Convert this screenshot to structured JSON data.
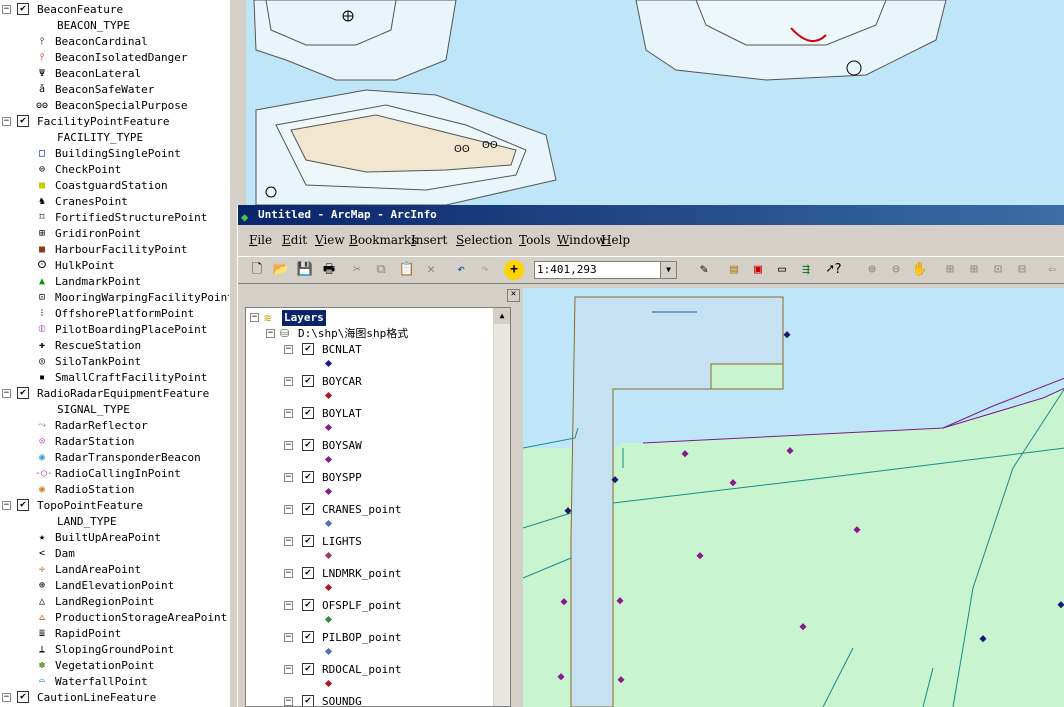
{
  "legend": {
    "items": [
      {
        "kind": "group",
        "label": "BeaconFeature"
      },
      {
        "kind": "field",
        "label": "BEACON_TYPE"
      },
      {
        "kind": "item",
        "label": "BeaconCardinal",
        "icon": "beacon-cardinal-icon",
        "glyph": "⫯",
        "color": "#000"
      },
      {
        "kind": "item",
        "label": "BeaconIsolatedDanger",
        "icon": "beacon-isolated-danger-icon",
        "glyph": "⫯",
        "color": "#d00"
      },
      {
        "kind": "item",
        "label": "BeaconLateral",
        "icon": "beacon-lateral-icon",
        "glyph": "Ψ",
        "color": "#000"
      },
      {
        "kind": "item",
        "label": "BeaconSafeWater",
        "icon": "beacon-safe-water-icon",
        "glyph": "ǎ",
        "color": "#000"
      },
      {
        "kind": "item",
        "label": "BeaconSpecialPurpose",
        "icon": "beacon-special-purpose-icon",
        "glyph": "ʘʘ",
        "color": "#000"
      },
      {
        "kind": "group",
        "label": "FacilityPointFeature"
      },
      {
        "kind": "field",
        "label": "FACILITY_TYPE"
      },
      {
        "kind": "item",
        "label": "BuildingSinglePoint",
        "icon": "building-single-point-icon",
        "glyph": "□",
        "color": "#00c"
      },
      {
        "kind": "item",
        "label": "CheckPoint",
        "icon": "check-point-icon",
        "glyph": "⊖",
        "color": "#000"
      },
      {
        "kind": "item",
        "label": "CoastguardStation",
        "icon": "coastguard-station-icon",
        "glyph": "■",
        "color": "#cc0"
      },
      {
        "kind": "item",
        "label": "CranesPoint",
        "icon": "cranes-point-icon",
        "glyph": "♞",
        "color": "#000"
      },
      {
        "kind": "item",
        "label": "FortifiedStructurePoint",
        "icon": "fortified-structure-icon",
        "glyph": "⌑",
        "color": "#000"
      },
      {
        "kind": "item",
        "label": "GridironPoint",
        "icon": "gridiron-point-icon",
        "glyph": "⊞",
        "color": "#000"
      },
      {
        "kind": "item",
        "label": "HarbourFacilityPoint",
        "icon": "harbour-facility-icon",
        "glyph": "■",
        "color": "#8b3a1a"
      },
      {
        "kind": "item",
        "label": "HulkPoint",
        "icon": "hulk-point-icon",
        "glyph": "ⵙ",
        "color": "#000"
      },
      {
        "kind": "item",
        "label": "LandmarkPoint",
        "icon": "landmark-point-icon",
        "glyph": "▲",
        "color": "#090"
      },
      {
        "kind": "item",
        "label": "MooringWarpingFacilityPoint",
        "icon": "mooring-warping-icon",
        "glyph": "⊡",
        "color": "#000"
      },
      {
        "kind": "item",
        "label": "OffshorePlatformPoint",
        "icon": "offshore-platform-icon",
        "glyph": "⁝",
        "color": "#000"
      },
      {
        "kind": "item",
        "label": "PilotBoardingPlacePoint",
        "icon": "pilot-boarding-icon",
        "glyph": "⦶",
        "color": "#a050c0"
      },
      {
        "kind": "item",
        "label": "RescueStation",
        "icon": "rescue-station-icon",
        "glyph": "✚",
        "color": "#000"
      },
      {
        "kind": "item",
        "label": "SiloTankPoint",
        "icon": "silo-tank-icon",
        "glyph": "◎",
        "color": "#000"
      },
      {
        "kind": "item",
        "label": "SmallCraftFacilityPoint",
        "icon": "small-craft-facility-icon",
        "glyph": "▪",
        "color": "#000"
      },
      {
        "kind": "group",
        "label": "RadioRadarEquipmentFeature"
      },
      {
        "kind": "field",
        "label": "SIGNAL_TYPE"
      },
      {
        "kind": "item",
        "label": "RadarReflector",
        "icon": "radar-reflector-icon",
        "glyph": "⤳",
        "color": "#888"
      },
      {
        "kind": "item",
        "label": "RadarStation",
        "icon": "radar-station-icon",
        "glyph": "⊙",
        "color": "#c040c0"
      },
      {
        "kind": "item",
        "label": "RadarTransponderBeacon",
        "icon": "radar-transponder-icon",
        "glyph": "◉",
        "color": "#3aa0d0"
      },
      {
        "kind": "item",
        "label": "RadioCallingInPoint",
        "icon": "radio-calling-in-icon",
        "glyph": "-○-",
        "color": "#c040c0"
      },
      {
        "kind": "item",
        "label": "RadioStation",
        "icon": "radio-station-icon",
        "glyph": "◉",
        "color": "#d08020"
      },
      {
        "kind": "group",
        "label": "TopoPointFeature"
      },
      {
        "kind": "field",
        "label": "LAND_TYPE"
      },
      {
        "kind": "item",
        "label": "BuiltUpAreaPoint",
        "icon": "built-up-area-icon",
        "glyph": "★",
        "color": "#000"
      },
      {
        "kind": "item",
        "label": "Dam",
        "icon": "dam-icon",
        "glyph": "<",
        "color": "#000"
      },
      {
        "kind": "item",
        "label": "LandAreaPoint",
        "icon": "land-area-icon",
        "glyph": "✛",
        "color": "#b07020"
      },
      {
        "kind": "item",
        "label": "LandElevationPoint",
        "icon": "land-elevation-icon",
        "glyph": "⊕",
        "color": "#000"
      },
      {
        "kind": "item",
        "label": "LandRegionPoint",
        "icon": "land-region-icon",
        "glyph": "△",
        "color": "#000"
      },
      {
        "kind": "item",
        "label": "ProductionStorageAreaPoint",
        "icon": "production-storage-icon",
        "glyph": "⩟",
        "color": "#c08040"
      },
      {
        "kind": "item",
        "label": "RapidPoint",
        "icon": "rapid-point-icon",
        "glyph": "≣",
        "color": "#000"
      },
      {
        "kind": "item",
        "label": "SlopingGroundPoint",
        "icon": "sloping-ground-icon",
        "glyph": "⍊",
        "color": "#000"
      },
      {
        "kind": "item",
        "label": "VegetationPoint",
        "icon": "vegetation-point-icon",
        "glyph": "✽",
        "color": "#4a8a20"
      },
      {
        "kind": "item",
        "label": "WaterfallPoint",
        "icon": "waterfall-point-icon",
        "glyph": "⌓",
        "color": "#3aa0d0"
      },
      {
        "kind": "group",
        "label": "CautionLineFeature"
      }
    ]
  },
  "window": {
    "title": "Untitled - ArcMap - ArcInfo",
    "menus": [
      {
        "label": "File",
        "u": "F",
        "rest": "ile"
      },
      {
        "label": "Edit",
        "u": "E",
        "rest": "dit"
      },
      {
        "label": "View",
        "u": "V",
        "rest": "iew"
      },
      {
        "label": "Bookmarks",
        "u": "B",
        "rest": "ookmarks"
      },
      {
        "label": "Insert",
        "u": "I",
        "rest": "nsert"
      },
      {
        "label": "Selection",
        "u": "S",
        "rest": "election"
      },
      {
        "label": "Tools",
        "u": "T",
        "rest": "ools"
      },
      {
        "label": "Window",
        "u": "W",
        "rest": "indow"
      },
      {
        "label": "Help",
        "u": "H",
        "rest": "elp"
      }
    ],
    "scale": "1:401,293"
  },
  "toc": {
    "root": "Layers",
    "path": "D:\\shp\\海图shp格式",
    "layers": [
      {
        "name": "BCNLAT",
        "color": "#1a1a8a"
      },
      {
        "name": "BOYCAR",
        "color": "#b0102a"
      },
      {
        "name": "BOYLAT",
        "color": "#8a1a8a"
      },
      {
        "name": "BOYSAW",
        "color": "#8a1a8a"
      },
      {
        "name": "BOYSPP",
        "color": "#8a1a8a"
      },
      {
        "name": "CRANES_point",
        "color": "#5a6ac0"
      },
      {
        "name": "LIGHTS",
        "color": "#a03a60"
      },
      {
        "name": "LNDMRK_point",
        "color": "#b0102a"
      },
      {
        "name": "OFSPLF_point",
        "color": "#3a8a3a"
      },
      {
        "name": "PILBOP_point",
        "color": "#5a6ac0"
      },
      {
        "name": "RDOCAL_point",
        "color": "#b0102a"
      },
      {
        "name": "SOUNDG",
        "color": "#5a6ac0"
      }
    ]
  }
}
